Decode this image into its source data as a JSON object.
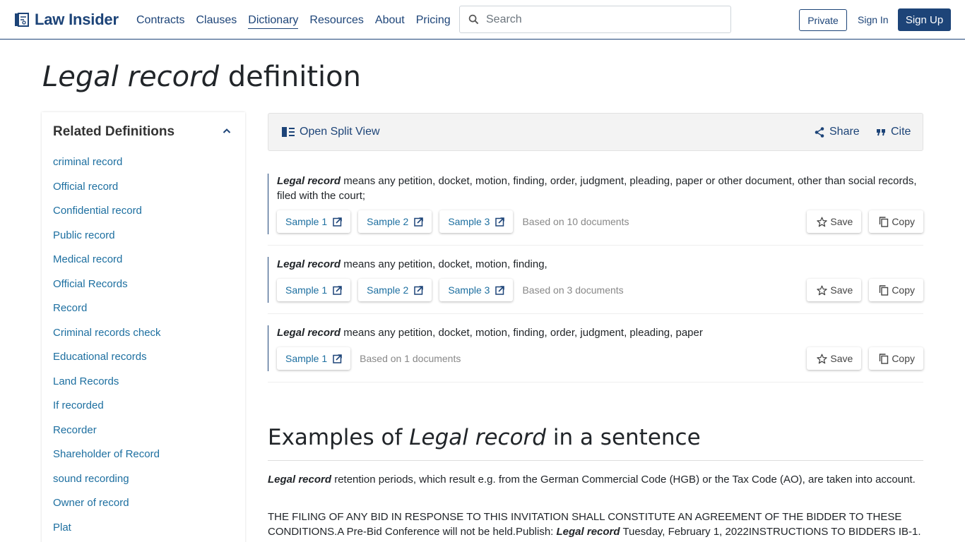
{
  "header": {
    "logo_text": "Law Insider",
    "nav": [
      "Contracts",
      "Clauses",
      "Dictionary",
      "Resources",
      "About",
      "Pricing"
    ],
    "search_placeholder": "Search",
    "private_label": "Private",
    "signin_label": "Sign In",
    "signup_label": "Sign Up"
  },
  "title": {
    "term": "Legal record",
    "suffix": " definition"
  },
  "sidebar": {
    "heading": "Related Definitions",
    "items": [
      "criminal record",
      "Official record",
      "Confidential record",
      "Public record",
      "Medical record",
      "Official Records",
      "Record",
      "Criminal records check",
      "Educational records",
      "Land Records",
      "If recorded",
      "Recorder",
      "Shareholder of Record",
      "sound recording",
      "Owner of record",
      "Plat"
    ]
  },
  "toolbar": {
    "split_view": "Open Split View",
    "share": "Share",
    "cite": "Cite"
  },
  "definitions": [
    {
      "term": "Legal record",
      "text": " means any petition, docket, motion, finding, order, judgment, pleading, paper or other document, other than social records, filed with the court;",
      "samples": [
        "Sample 1",
        "Sample 2",
        "Sample 3"
      ],
      "based_on": "Based on 10 documents"
    },
    {
      "term": "Legal record",
      "text": " means any petition, docket, motion, finding,",
      "samples": [
        "Sample 1",
        "Sample 2",
        "Sample 3"
      ],
      "based_on": "Based on 3 documents"
    },
    {
      "term": "Legal record",
      "text": " means any petition, docket, motion, finding, order, judgment, pleading, paper",
      "samples": [
        "Sample 1"
      ],
      "based_on": "Based on 1 documents"
    }
  ],
  "actions": {
    "save": "Save",
    "copy": "Copy"
  },
  "examples": {
    "prefix": "Examples of ",
    "term": "Legal record",
    "suffix": " in a sentence",
    "ex1": {
      "term": "Legal record",
      "text": " retention periods, which result e.g. from the German Commercial Code (HGB) or the Tax Code (AO), are taken into account."
    },
    "ex2": {
      "before": "THE FILING OF ANY BID IN RESPONSE TO THIS INVITATION SHALL CONSTITUTE AN AGREEMENT OF THE BIDDER TO THESE CONDITIONS.A Pre-Bid Conference will not be held.Publish: ",
      "term": "Legal record",
      "after": " Tuesday, February 1, 2022INSTRUCTIONS TO BIDDERS IB-1."
    }
  },
  "colors": {
    "brand": "#1d4478",
    "link": "#1d6fa0"
  }
}
